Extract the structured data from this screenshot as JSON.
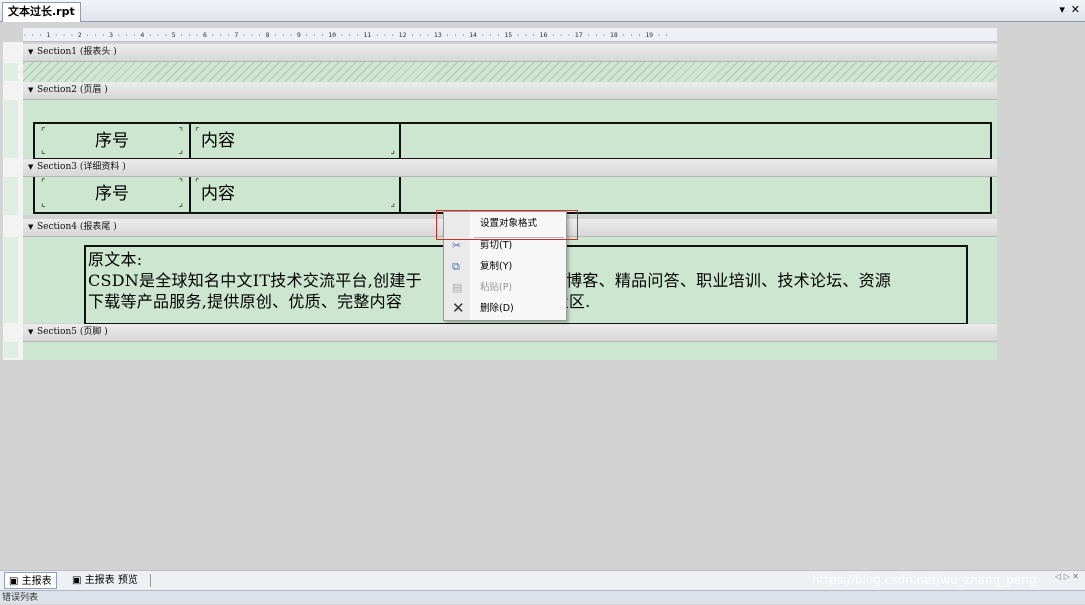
{
  "tab": {
    "title": "文本过长.rpt",
    "menu_glyph": "▾ ✕"
  },
  "ruler": {
    "text": "· · · 1 · · · 2 · · · 3 · · · 4 · · · 5 · · · 6 · · · 7 · · · 8 · · · 9 · · · 10 · · · 11 · · · 12 · · · 13 · · · 14 · · · 15 · · · 16 · · · 17 · · · 18 · · · 19 · ·"
  },
  "sections": [
    {
      "label": "Section1 (报表头 )"
    },
    {
      "label": "Section2 (页眉 )"
    },
    {
      "label": "Section3 (详细资料 )"
    },
    {
      "label": "Section4 (报表尾 )"
    },
    {
      "label": "Section5 (页脚 )"
    }
  ],
  "page_header": {
    "field1": "序号",
    "field2": "内容"
  },
  "details": {
    "field1": "序号",
    "field2": "内容"
  },
  "report_footer": {
    "line1": "原文本:",
    "line2": "CSDN是全球知名中文IT技术交流平台,创建于",
    "line2b": "创博客、精品问答、职业培训、技术论坛、资源",
    "line3": "下载等产品服务,提供原创、优质、完整内容",
    "line3b": "开发社区."
  },
  "context_menu": {
    "items": [
      {
        "label": "设置对象格式",
        "icon": "format-icon"
      },
      {
        "label": "剪切(T)",
        "icon": "scissors-icon"
      },
      {
        "label": "复制(Y)",
        "icon": "copy-icon"
      },
      {
        "label": "粘贴(P)",
        "icon": "paste-icon",
        "disabled": true
      },
      {
        "label": "删除(D)",
        "icon": "delete-x-icon"
      }
    ]
  },
  "bottom_tabs": {
    "main": "主报表",
    "preview": "主报表 预览"
  },
  "watermark": "https://blog.csdn.net/wu_zhang_peng",
  "error_panel": {
    "title": "错误列表"
  },
  "colors": {
    "band": "#cce6d0",
    "highlight": "#d52a2a"
  }
}
